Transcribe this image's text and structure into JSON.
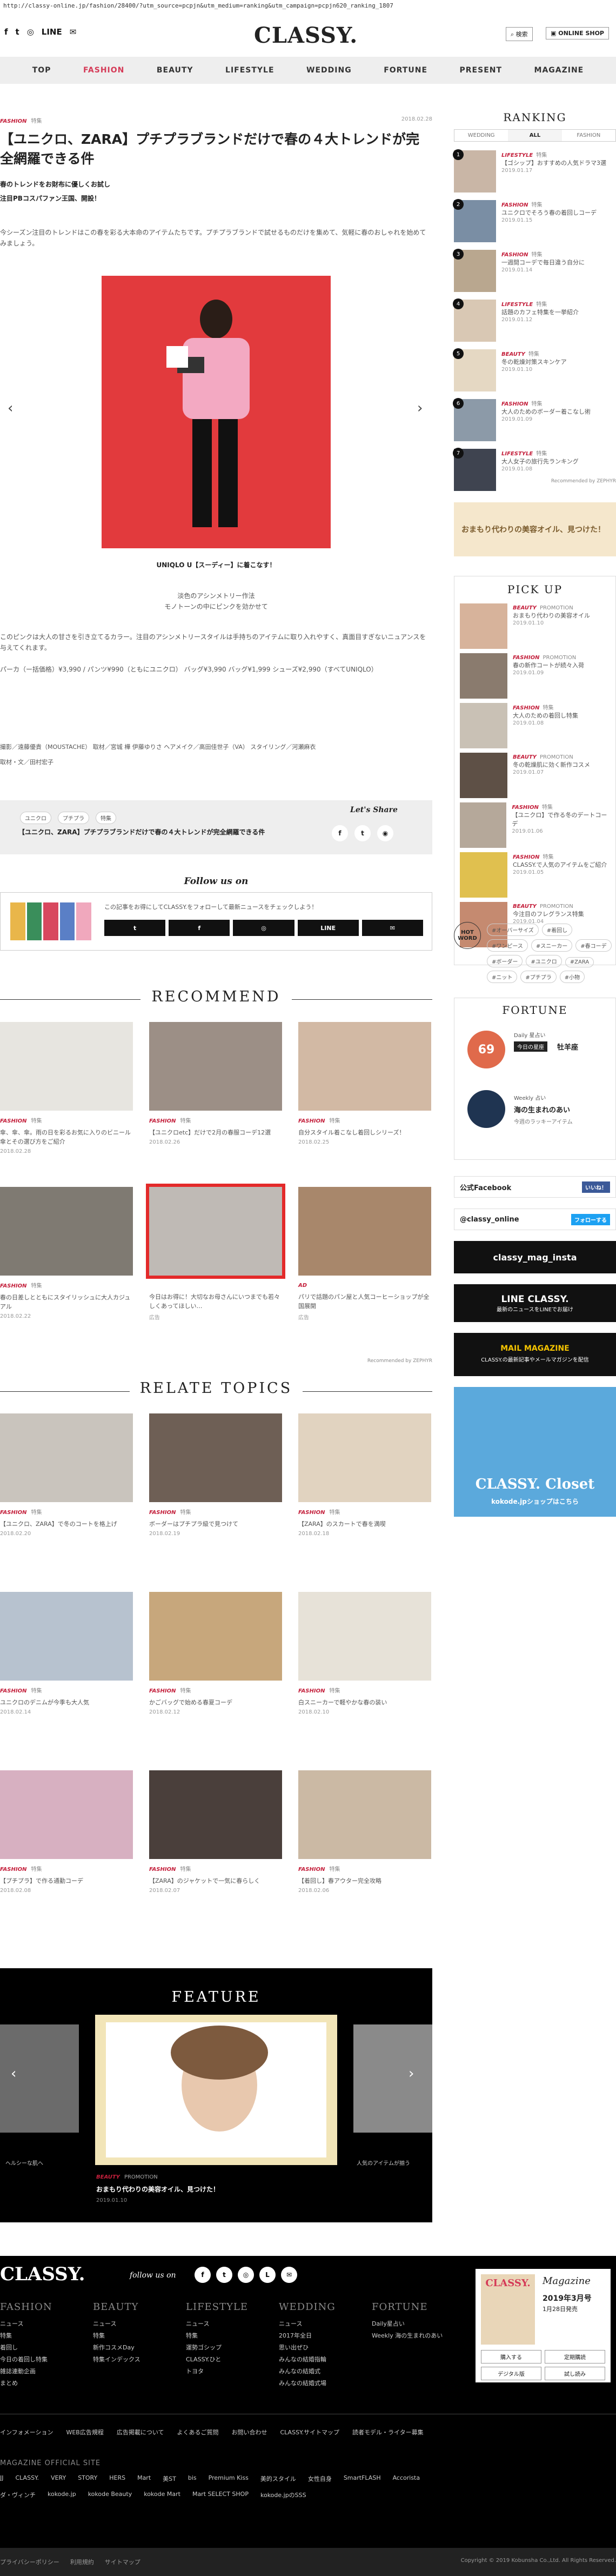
{
  "url": "http://classy-online.jp/fashion/28400/?utm_source=pcpjn&utm_medium=ranking&utm_campaign=pcpjn620_ranking_1807",
  "header": {
    "social": [
      "f",
      "t",
      "◎",
      "LINE",
      "✉"
    ],
    "logo": "CLASSY.",
    "search": "検索",
    "shop": "ONLINE SHOP"
  },
  "nav": [
    "TOP",
    "FASHION",
    "BEAUTY",
    "LIFESTYLE",
    "WEDDING",
    "FORTUNE",
    "PRESENT",
    "MAGAZINE"
  ],
  "article": {
    "category": "FASHION",
    "subcategory": "特集",
    "date": "2018.02.28",
    "title": "【ユニクロ、ZARA】プチプラブランドだけで春の４大トレンドが完全網羅できる件",
    "lead1": "春のトレンドをお財布に優しくお試し",
    "lead2": "注目PBコスパファン王国、開設！",
    "body1": "今シーズン注目のトレンドはこの春を彩る大本命のアイテムたちです。プチプラブランドで試せるものだけを集めて、気軽に春のおしゃれを始めてみましょう。",
    "caption": "UNIQLO U【スーディー】に着こなす！",
    "sub_caption1": "淡色のアシンメトリー作法",
    "sub_caption2": "モノトーンの中にピンクを効かせて",
    "body2": "このピンクは大人の甘さを引き立てるカラー。注目のアシンメトリースタイルは手持ちのアイテムに取り入れやすく、真面目すぎないニュアンスを与えてくれます。",
    "price_line": "パーカ（ー括価格）¥3,990 / パンツ¥990（ともにユニクロ） バッグ¥3,990 バッグ¥1,999 シューズ¥2,990（すべてUNIQLO）",
    "credits1": "撮影／遠藤優貴（MOUSTACHE） 取材／宮城 樺 伊藤ゆりさ ヘアメイク／高田佳世子（VA） スタイリング／河瀬麻衣",
    "credits2": "取材・文／田村宏子",
    "share_tags": [
      "ユニクロ",
      "プチプラ",
      "特集"
    ],
    "share_title": "【ユニクロ、ZARA】プチプラブランドだけで春の４大トレンドが完全網羅できる件",
    "share_label": "Let's Share",
    "share_icons": [
      "f",
      "t",
      "◉"
    ],
    "follow_title": "Follow us on",
    "follow_text": "この記事をお得にしてCLASSY.をフォローして最新ニュースをチェックしよう！",
    "follow_btns": [
      "t",
      "f",
      "◎",
      "LINE",
      "✉"
    ]
  },
  "recommend": {
    "title": "RECOMMEND",
    "items": [
      {
        "cat": "FASHION",
        "sub": "特集",
        "title": "傘、傘、傘。雨の日を彩るお気に入りのビニール傘とその選び方をご紹介",
        "date": "2018.02.28"
      },
      {
        "cat": "FASHION",
        "sub": "特集",
        "title": "【ユニクロetc】だけで2月の春服コーデ12選",
        "date": "2018.02.26"
      },
      {
        "cat": "FASHION",
        "sub": "特集",
        "title": "自分スタイル着こなし着回しシリーズ！",
        "date": "2018.02.25"
      },
      {
        "cat": "FASHION",
        "sub": "特集",
        "title": "春の日差しとともにスタイリッシュに大人カジュアル",
        "date": "2018.02.22"
      },
      {
        "cat": "",
        "sub": "",
        "title": "今日はお得に！大切なお母さんにいつまでも若々しくあってほしい…",
        "date": "広告"
      },
      {
        "cat": "AD",
        "sub": "",
        "title": "パリで話題のパン屋と人気コーヒーショップが全国展開",
        "date": "広告"
      }
    ],
    "credit": "Recommended by ZEPHYR"
  },
  "relate": {
    "title": "RELATE TOPICS",
    "items": [
      {
        "cat": "FASHION",
        "sub": "特集",
        "title": "【ユニクロ、ZARA】で冬のコートを格上げ",
        "date": "2018.02.20"
      },
      {
        "cat": "FASHION",
        "sub": "特集",
        "title": "ボーダーはプチプラ級で見つけて",
        "date": "2018.02.19"
      },
      {
        "cat": "FASHION",
        "sub": "特集",
        "title": "【ZARA】のスカートで春を満喫",
        "date": "2018.02.18"
      },
      {
        "cat": "FASHION",
        "sub": "特集",
        "title": "ユニクロのデニムが今季も大人気",
        "date": "2018.02.14"
      },
      {
        "cat": "FASHION",
        "sub": "特集",
        "title": "かごバッグで始める春夏コーデ",
        "date": "2018.02.12"
      },
      {
        "cat": "FASHION",
        "sub": "特集",
        "title": "白スニーカーで軽やかな春の装い",
        "date": "2018.02.10"
      },
      {
        "cat": "FASHION",
        "sub": "特集",
        "title": "【プチプラ】で作る通勤コーデ",
        "date": "2018.02.08"
      },
      {
        "cat": "FASHION",
        "sub": "特集",
        "title": "【ZARA】のジャケットで一気に春らしく",
        "date": "2018.02.07"
      },
      {
        "cat": "FASHION",
        "sub": "特集",
        "title": "【着回し】春アウター完全攻略",
        "date": "2018.02.06"
      }
    ]
  },
  "feature": {
    "title": "FEATURE",
    "cat": "BEAUTY",
    "sub": "PROMOTION",
    "item": "おまもり代わりの美容オイル、見つけた！",
    "date": "2019.01.10",
    "left_caption": "ヘルシーな肌へ",
    "right_caption": "人気のアイテムが揃う"
  },
  "sidebar": {
    "ranking_title": "RANKING",
    "tabs": [
      "WEDDING",
      "ALL",
      "FASHION"
    ],
    "ranking": [
      {
        "n": "1",
        "cat": "LIFESTYLE",
        "sub": "特集",
        "title": "【ゴシップ】おすすめの人気ドラマ3選",
        "date": "2019.01.17"
      },
      {
        "n": "2",
        "cat": "FASHION",
        "sub": "特集",
        "title": "ユニクロでそろう春の着回しコーデ",
        "date": "2019.01.15"
      },
      {
        "n": "3",
        "cat": "FASHION",
        "sub": "特集",
        "title": "一週間コーデで毎日違う自分に",
        "date": "2019.01.14"
      },
      {
        "n": "4",
        "cat": "LIFESTYLE",
        "sub": "特集",
        "title": "話題のカフェ特集を一挙紹介",
        "date": "2019.01.12"
      },
      {
        "n": "5",
        "cat": "BEAUTY",
        "sub": "特集",
        "title": "冬の乾燥対策スキンケア",
        "date": "2019.01.10"
      },
      {
        "n": "6",
        "cat": "FASHION",
        "sub": "特集",
        "title": "大人のためのボーダー着こなし術",
        "date": "2019.01.09"
      },
      {
        "n": "7",
        "cat": "LIFESTYLE",
        "sub": "特集",
        "title": "大人女子の旅行先ランキング",
        "date": "2019.01.08"
      }
    ],
    "ranking_credit": "Recommended by ZEPHYR",
    "banner_text": "おまもり代わりの美容オイル、見つけた！",
    "pickup_title": "PICK UP",
    "pickup": [
      {
        "cat": "BEAUTY",
        "sub": "PROMOTION",
        "title": "おまもり代わりの美容オイル",
        "date": "2019.01.10"
      },
      {
        "cat": "FASHION",
        "sub": "PROMOTION",
        "title": "春の新作コートが続々入荷",
        "date": "2019.01.09"
      },
      {
        "cat": "FASHION",
        "sub": "特集",
        "title": "大人のための着回し特集",
        "date": "2019.01.08"
      },
      {
        "cat": "BEAUTY",
        "sub": "PROMOTION",
        "title": "冬の乾燥肌に効く新作コスメ",
        "date": "2019.01.07"
      },
      {
        "cat": "FASHION",
        "sub": "特集",
        "title": "【ユニクロ】で作る冬のデートコーデ",
        "date": "2019.01.06"
      },
      {
        "cat": "FASHION",
        "sub": "特集",
        "title": "CLASSY.で人気のアイテムをご紹介",
        "date": "2019.01.05"
      },
      {
        "cat": "BEAUTY",
        "sub": "PROMOTION",
        "title": "今注目のフレグランス特集",
        "date": "2019.01.04"
      }
    ],
    "hotword_label": "HOT WORD",
    "tags": [
      "#オーバーサイズ",
      "#着回し",
      "#ワンピース",
      "#スニーカー",
      "#春コーデ",
      "#ボーダー",
      "#ユニクロ",
      "#ZARA",
      "#ニット",
      "#プチプラ",
      "#小物"
    ],
    "fortune_title": "FORTUNE",
    "daily_label": "Daily 星占い",
    "daily_sign": "今日の星座",
    "daily_score": "69",
    "daily_name": "牡羊座",
    "weekly_label": "Weekly 占い",
    "weekly_name": "海の生まれのあい",
    "weekly_sub": "今週のラッキーアイテム",
    "fb_label": "公式Facebook",
    "fb_btn": "いいね！",
    "tw_label": "@classy_online",
    "tw_btn": "フォローする",
    "ig_label": "classy_mag_insta",
    "line_label": "LINE CLASSY.",
    "line_sub": "最新のニュースをLINEでお届け",
    "mail_title": "MAIL MAGAZINE",
    "mail_sub": "CLASSY.の最新記事やメールマガジンを配信",
    "closet_title": "CLASSY. Closet",
    "closet_sub": "kokode.jpショップはこちら"
  },
  "footer": {
    "logo": "CLASSY.",
    "follow": "follow us on",
    "icons": [
      "f",
      "t",
      "◎",
      "L",
      "✉"
    ],
    "cols": [
      {
        "h": "FASHION",
        "items": [
          "ニュース",
          "特集",
          "着回し",
          "今日の着回し特集",
          "雑誌連動企画",
          "まとめ"
        ]
      },
      {
        "h": "BEAUTY",
        "items": [
          "ニュース",
          "特集",
          "新作コスメDay",
          "特集インデックス"
        ]
      },
      {
        "h": "LIFESTYLE",
        "items": [
          "ニュース",
          "特集",
          "運勢ゴシップ",
          "CLASSY.ひと",
          "トヨタ"
        ]
      },
      {
        "h": "WEDDING",
        "items": [
          "ニュース",
          "2017年全日",
          "思い出ぜひ",
          "みんなの結婚指輪",
          "みんなの結婚式",
          "みんなの結婚式場"
        ]
      },
      {
        "h": "FORTUNE",
        "items": [
          "Daily星占い",
          "Weekly 海の生まれのあい"
        ]
      }
    ],
    "mag_label": "Magazine",
    "mag_date": "2019年3月号",
    "mag_sub": "1月28日発売",
    "mag_buttons": [
      "購入する",
      "定期購読",
      "デジタル版",
      "試し読み"
    ],
    "links": [
      "インフォメーション",
      "WEB広告規程",
      "広告掲載について",
      "よくあるご質問",
      "お問い合わせ",
      "CLASSY.サイトマップ",
      "読者モデル・ライター募集"
    ],
    "official_title": "MAGAZINE OFFICIAL SITE",
    "official": [
      "JJ",
      "CLASSY.",
      "VERY",
      "STORY",
      "HERS",
      "Mart",
      "美ST",
      "bis",
      "Premium Kiss",
      "美的スタイル",
      "女性自身",
      "SmartFLASH",
      "Accorista",
      "ダ・ヴィンチ",
      "kokode.jp",
      "kokode Beauty",
      "kokode Mart",
      "Mart SELECT SHOP",
      "kokode.jpのSSS"
    ],
    "bottom_links": [
      "プライバシーポリシー",
      "利用規約",
      "サイトマップ"
    ],
    "copyright": "Copyright © 2019 Kobunsha Co.,Ltd. All Rights Reserved."
  }
}
